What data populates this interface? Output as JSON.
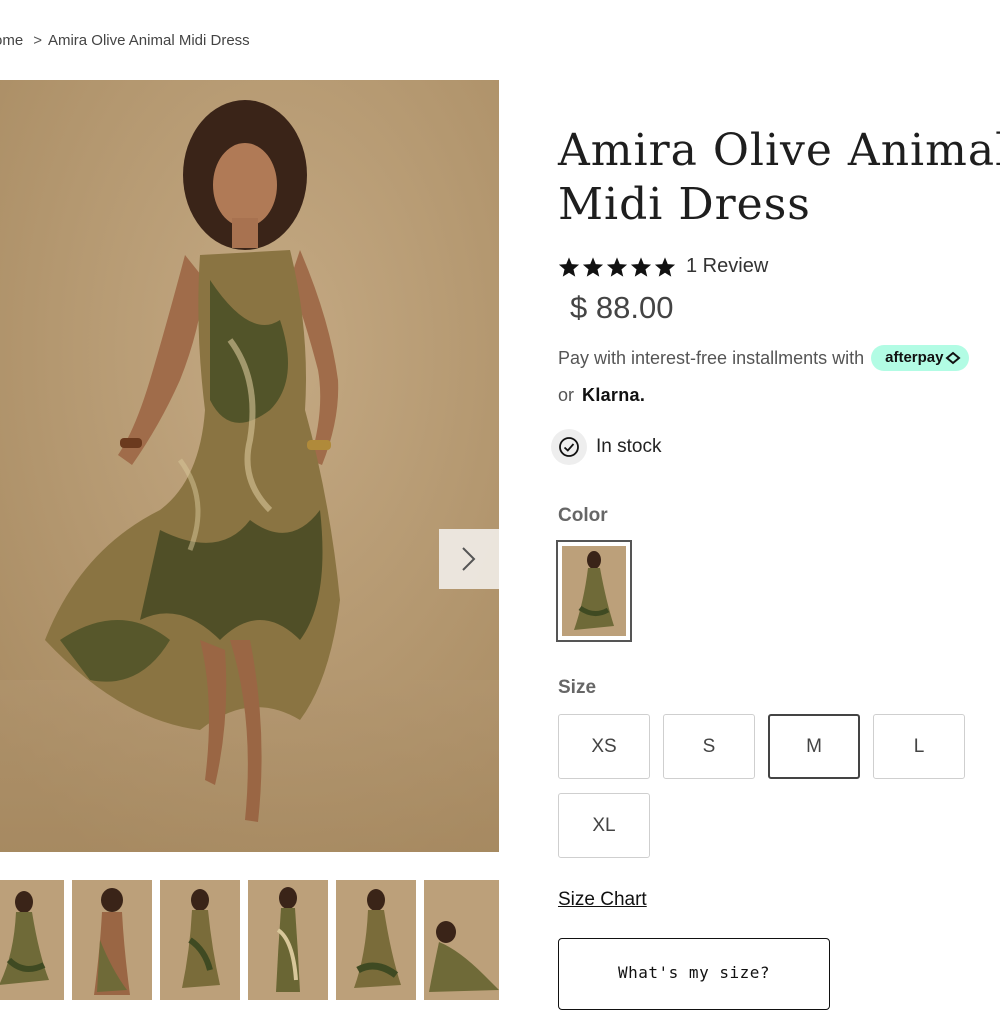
{
  "breadcrumb": {
    "home": "ome",
    "current": "Amira Olive Animal Midi Dress"
  },
  "product": {
    "title_line1": "Amira Olive Animal",
    "title_line2": "Midi Dress",
    "rating_stars": 5,
    "review_text": "1 Review",
    "price": "$ 88.00",
    "installments_text": "Pay with interest-free installments with",
    "afterpay_label": "afterpay",
    "klarna_prefix": "or",
    "klarna_label": "Klarna.",
    "stock_text": "In stock"
  },
  "color": {
    "label": "Color"
  },
  "size": {
    "label": "Size",
    "options": [
      "XS",
      "S",
      "M",
      "L",
      "XL"
    ],
    "selected": "M"
  },
  "size_chart_label": "Size Chart",
  "whats_my_size_label": "What's my size?",
  "icons": {
    "next": "chevron-right-icon",
    "star": "star-icon",
    "stock": "check-circle-icon",
    "afterpay": "afterpay-arrows-icon"
  },
  "colors": {
    "afterpay_mint": "#b2fce4",
    "backdrop_tan": "#b69a72",
    "dress_olive": "#3f4a22"
  }
}
